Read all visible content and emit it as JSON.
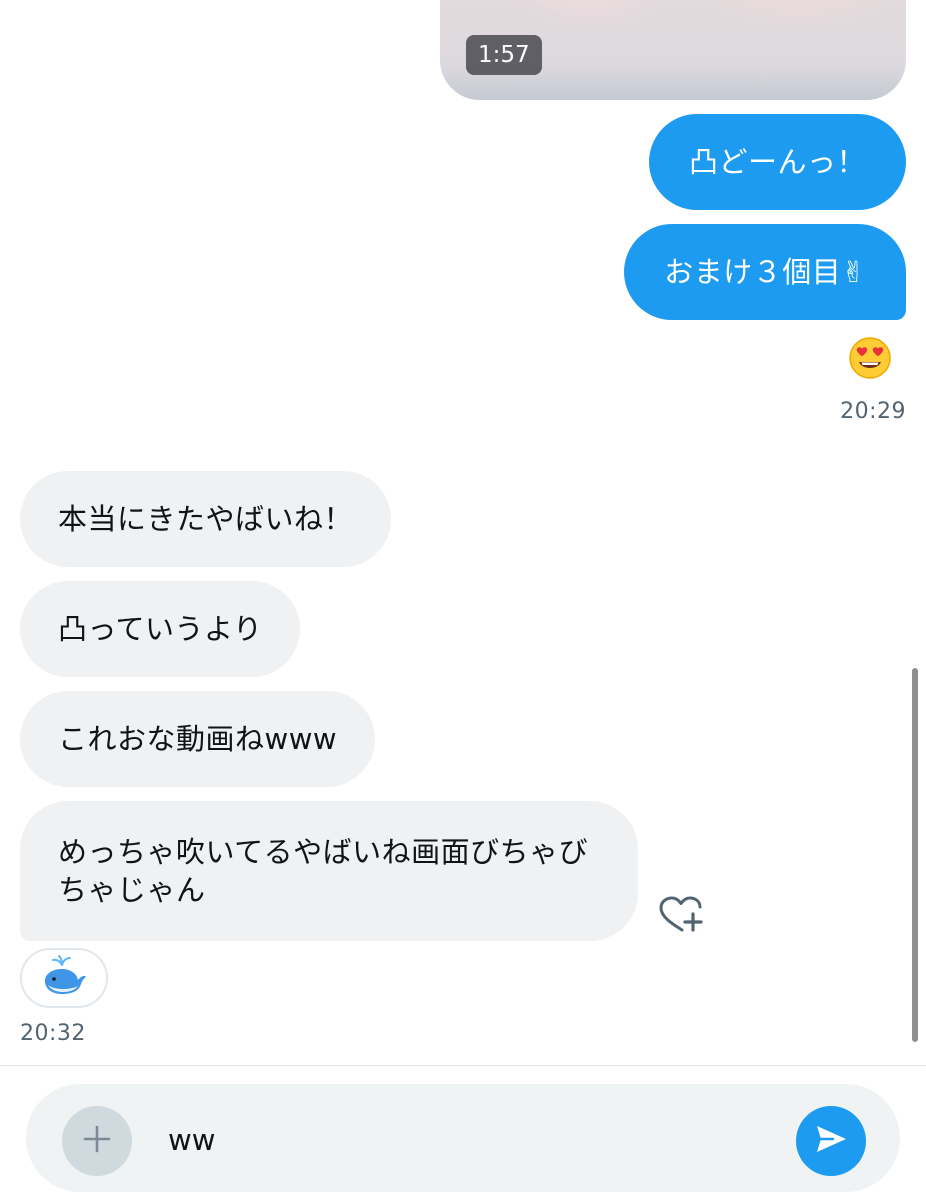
{
  "video_message": {
    "duration": "1:57"
  },
  "outgoing": {
    "messages": [
      {
        "text": "凸どーんっ！"
      },
      {
        "text": "おまけ３個目✌"
      }
    ],
    "reaction_icon": "heart-eyes-face-icon",
    "timestamp": "20:29"
  },
  "incoming": {
    "messages": [
      {
        "text": "本当にきたやばいね！"
      },
      {
        "text": "凸っていうより"
      },
      {
        "text": "これおな動画ねwww"
      },
      {
        "text": "めっちゃ吹いてるやばいね画面びちゃびちゃじゃん"
      }
    ],
    "reaction_icon": "spouting-whale-icon",
    "add_reaction_icon": "heart-plus-icon",
    "timestamp": "20:32"
  },
  "composer": {
    "value": "ww",
    "add_icon": "plus-icon",
    "send_icon": "send-arrow-icon"
  },
  "colors": {
    "accent": "#1d9bf0",
    "incoming_bubble": "#eff1f3",
    "secondary_text": "#536471"
  }
}
